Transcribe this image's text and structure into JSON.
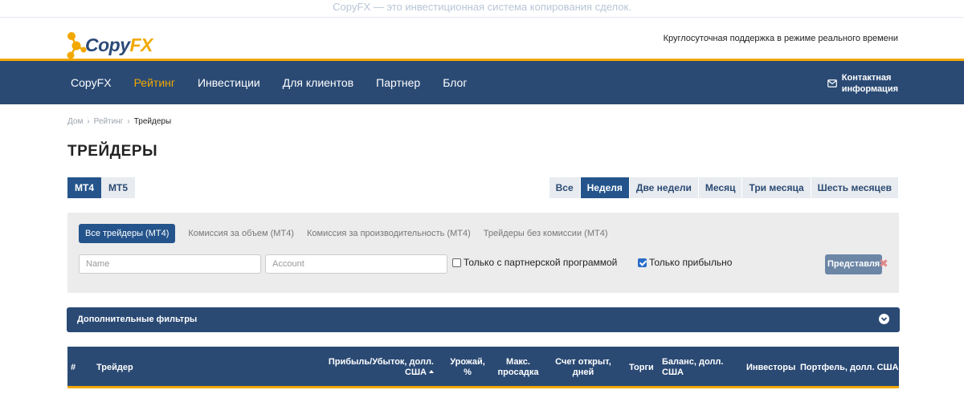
{
  "banner": "CopyFX — это инвестиционная система копирования сделок.",
  "logo": {
    "copy": "Copy",
    "fx": "FX"
  },
  "support_text": "Круглосуточная поддержка в режиме реального времени",
  "nav": {
    "items": [
      {
        "label": "CopyFX",
        "active": false
      },
      {
        "label": "Рейтинг",
        "active": true
      },
      {
        "label": "Инвестиции",
        "active": false
      },
      {
        "label": "Для клиентов",
        "active": false
      },
      {
        "label": "Партнер",
        "active": false
      },
      {
        "label": "Блог",
        "active": false
      }
    ],
    "contact_line1": "Контактная",
    "contact_line2": "информация"
  },
  "breadcrumb": {
    "home": "Дом",
    "rating": "Рейтинг",
    "current": "Трейдеры",
    "sep": "›"
  },
  "page_title": "ТРЕЙДЕРЫ",
  "platform_tabs": [
    {
      "label": "MT4",
      "active": true
    },
    {
      "label": "MT5",
      "active": false
    }
  ],
  "period_tabs": [
    {
      "label": "Все",
      "active": false
    },
    {
      "label": "Неделя",
      "active": true
    },
    {
      "label": "Две недели",
      "active": false
    },
    {
      "label": "Месяц",
      "active": false
    },
    {
      "label": "Три месяца",
      "active": false
    },
    {
      "label": "Шесть месяцев",
      "active": false
    }
  ],
  "filters": {
    "tabs": [
      {
        "label": "Все трейдеры (MT4)",
        "active": true
      },
      {
        "label": "Комиссия за объем (MT4)",
        "active": false
      },
      {
        "label": "Комиссия за производительность (MT4)",
        "active": false
      },
      {
        "label": "Трейдеры без комиссии (MT4)",
        "active": false
      }
    ],
    "name_placeholder": "Name",
    "account_placeholder": "Account",
    "partner_only_label": "Только с партнерской программой",
    "partner_only_checked": false,
    "profitable_only_label": "Только прибыльно",
    "profitable_only_checked": true,
    "apply_label": "Представля",
    "reset_symbol": "✖"
  },
  "extra_filters_label": "Дополнительные фильтры",
  "table": {
    "columns": {
      "num": "#",
      "trader": "Трейдер",
      "pnl_1": "Прибыль/Убыток, долл.",
      "pnl_2": "США",
      "yield_1": "Урожай,",
      "yield_2": "%",
      "dd_1": "Макс.",
      "dd_2": "просадка",
      "open_1": "Счет открыт,",
      "open_2": "дней",
      "trades": "Торги",
      "bal_1": "Баланс, долл.",
      "bal_2": "США",
      "investors": "Инвесторы",
      "portfolio": "Портфель, долл. США"
    }
  }
}
